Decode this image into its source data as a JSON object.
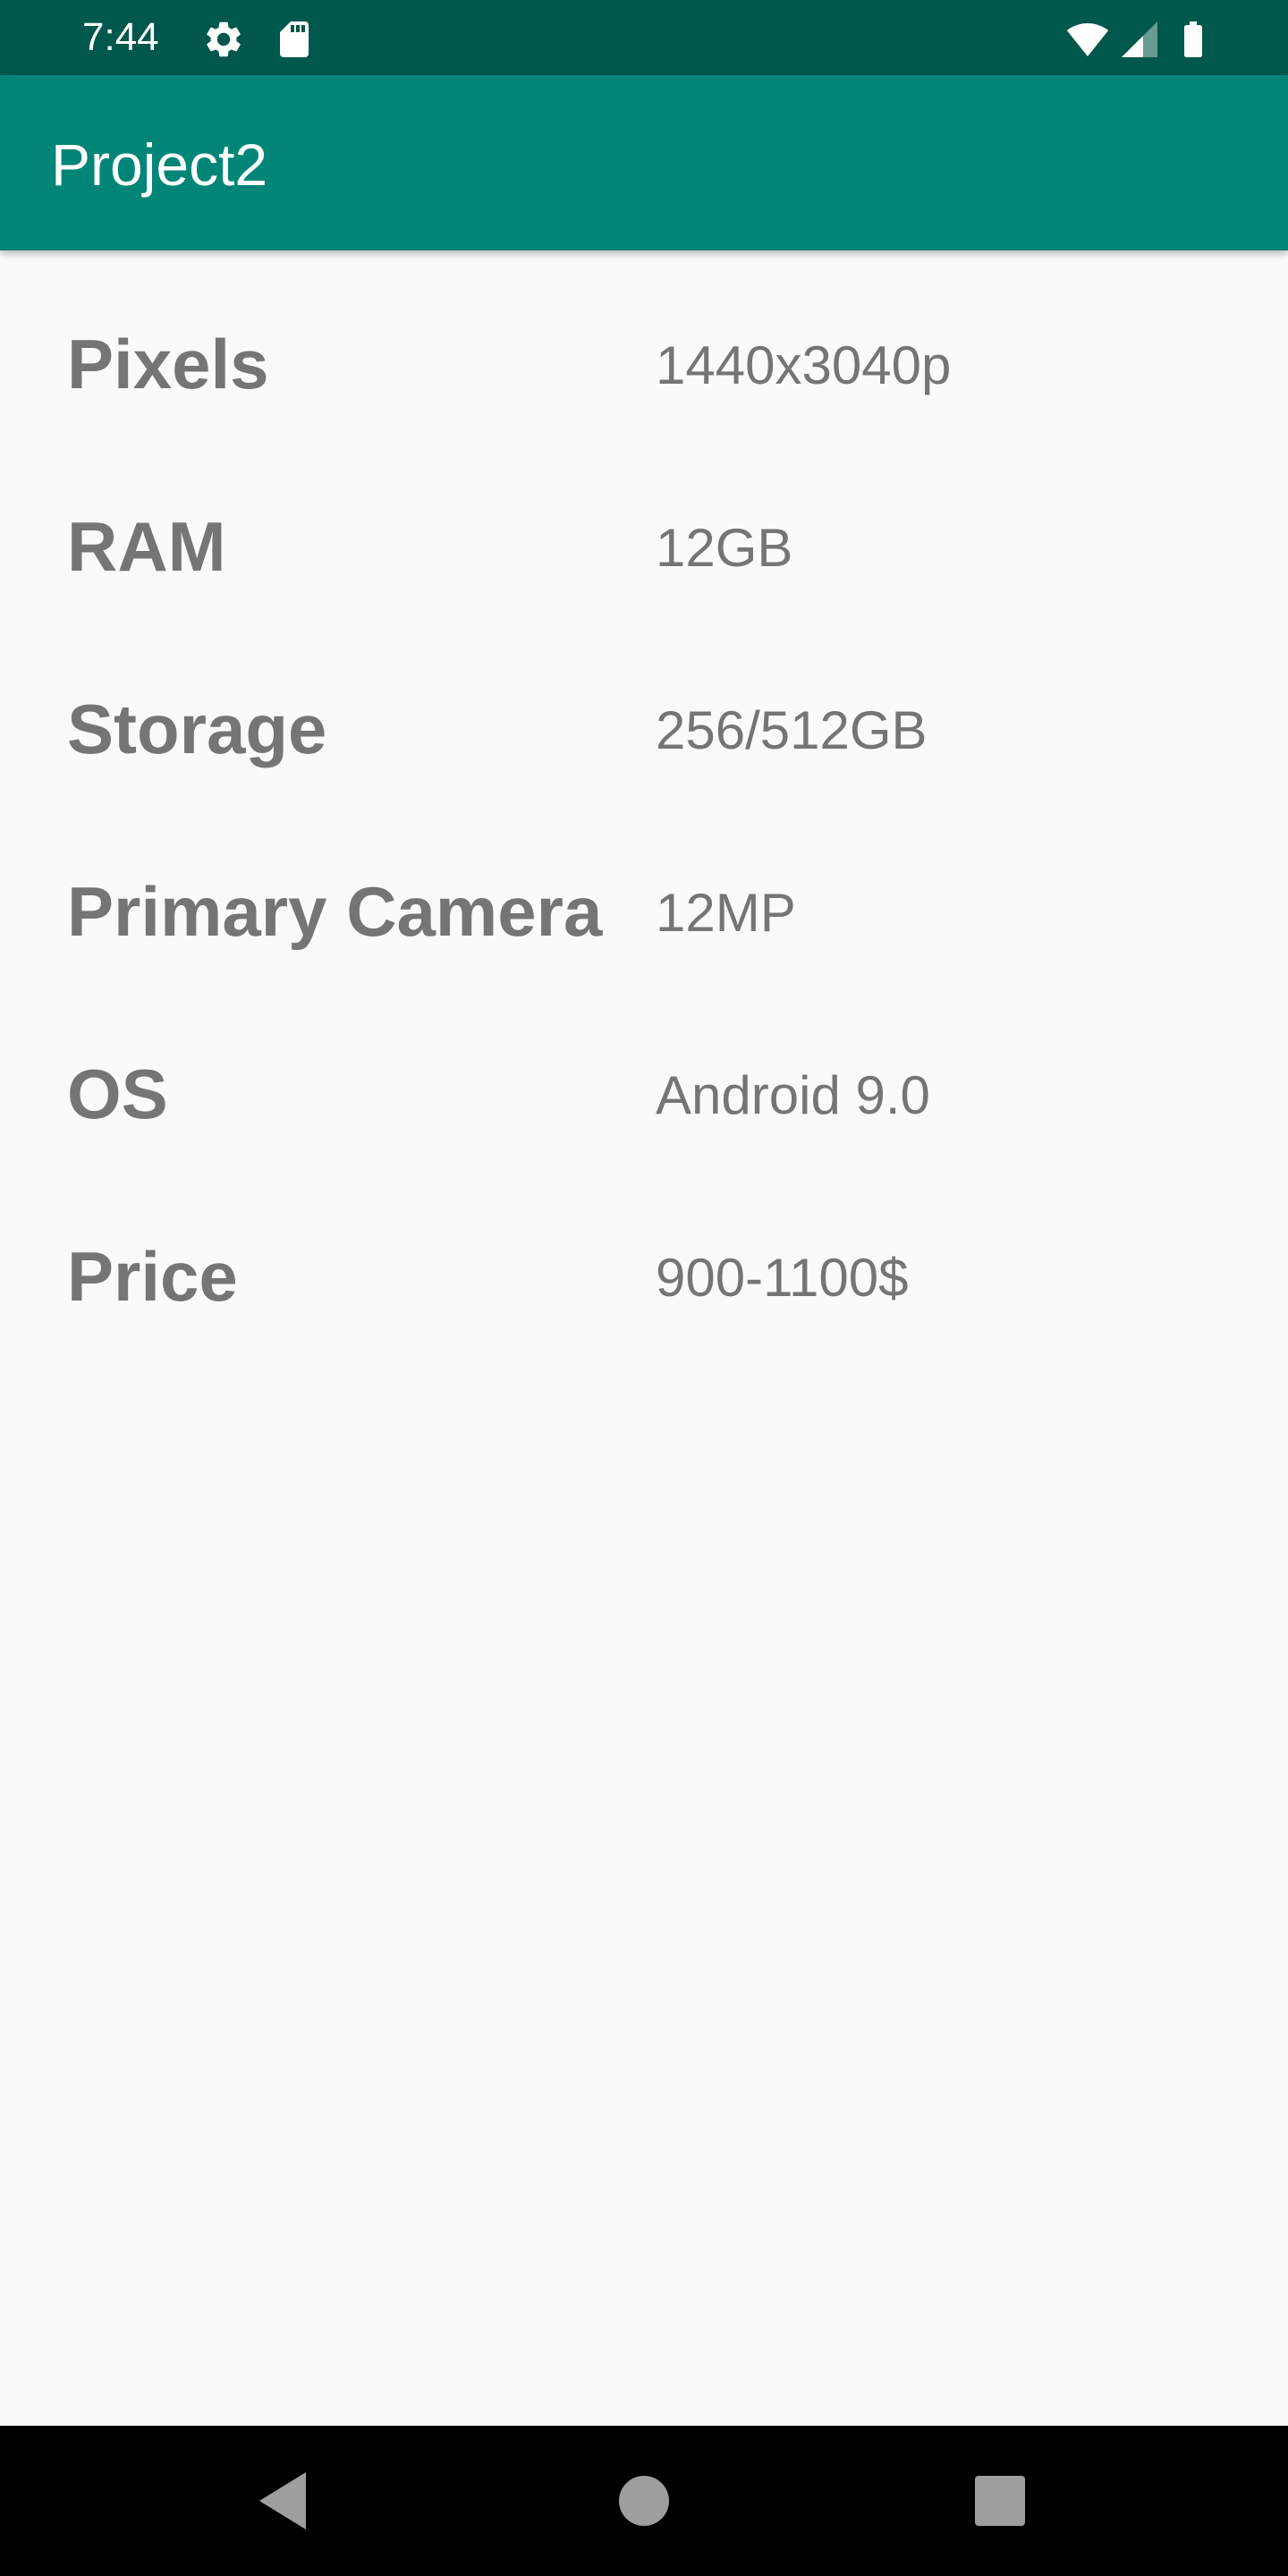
{
  "status_bar": {
    "time": "7:44",
    "icons": [
      "gear-icon",
      "sd-card-icon",
      "wifi-icon",
      "cell-signal-icon",
      "battery-icon"
    ]
  },
  "app_bar": {
    "title": "Project2",
    "color": "#008577",
    "status_color": "#00574b"
  },
  "specs": [
    {
      "label": "Pixels",
      "value": "1440x3040p"
    },
    {
      "label": "RAM",
      "value": "12GB"
    },
    {
      "label": "Storage",
      "value": "256/512GB"
    },
    {
      "label": "Primary Camera",
      "value": "12MP"
    },
    {
      "label": "OS",
      "value": "Android 9.0"
    },
    {
      "label": "Price",
      "value": "900-1100$"
    }
  ],
  "nav_bar": {
    "icons": [
      "back-icon",
      "home-icon",
      "recents-icon"
    ]
  }
}
